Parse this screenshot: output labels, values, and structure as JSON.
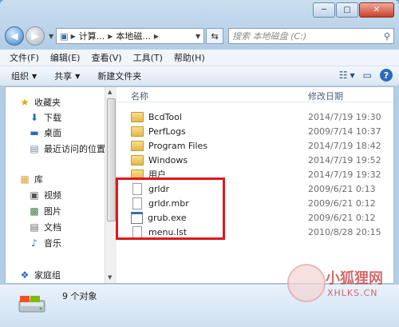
{
  "window": {
    "controls": {
      "minimize": "─",
      "maximize": "□",
      "close": "✕"
    }
  },
  "address": {
    "crumbs": [
      "计算...",
      "本地磁..."
    ],
    "search_placeholder": "搜索 本地磁盘 (C:)"
  },
  "menubar": [
    "文件(F)",
    "编辑(E)",
    "查看(V)",
    "工具(T)",
    "帮助(H)"
  ],
  "toolbar": {
    "organize": "组织",
    "share": "共享",
    "new_folder": "新建文件夹"
  },
  "nav": {
    "favorites": "收藏夹",
    "downloads": "下载",
    "desktop": "桌面",
    "recent": "最近访问的位置",
    "libraries": "库",
    "videos": "视频",
    "pictures": "图片",
    "documents": "文档",
    "music": "音乐",
    "homegroup": "家庭组"
  },
  "columns": {
    "name": "名称",
    "date": "修改日期"
  },
  "files": [
    {
      "name": "BcdTool",
      "date": "2014/7/19 19:30",
      "type": "folder"
    },
    {
      "name": "PerfLogs",
      "date": "2009/7/14 10:37",
      "type": "folder"
    },
    {
      "name": "Program Files",
      "date": "2014/7/19 18:42",
      "type": "folder"
    },
    {
      "name": "Windows",
      "date": "2014/7/19 19:52",
      "type": "folder"
    },
    {
      "name": "用户",
      "date": "2014/7/19 19:32",
      "type": "folder"
    },
    {
      "name": "grldr",
      "date": "2009/6/21 0:13",
      "type": "file"
    },
    {
      "name": "grldr.mbr",
      "date": "2009/6/21 0:12",
      "type": "file"
    },
    {
      "name": "grub.exe",
      "date": "2009/6/21 0:12",
      "type": "exe"
    },
    {
      "name": "menu.lst",
      "date": "2010/8/28 20:15",
      "type": "file"
    }
  ],
  "status": {
    "count": "9 个对象"
  },
  "watermark": {
    "title": "小狐狸网",
    "url": "XHLKS.CN"
  },
  "colors": {
    "highlight": "#e0171c",
    "folder": "#e3b84b"
  }
}
